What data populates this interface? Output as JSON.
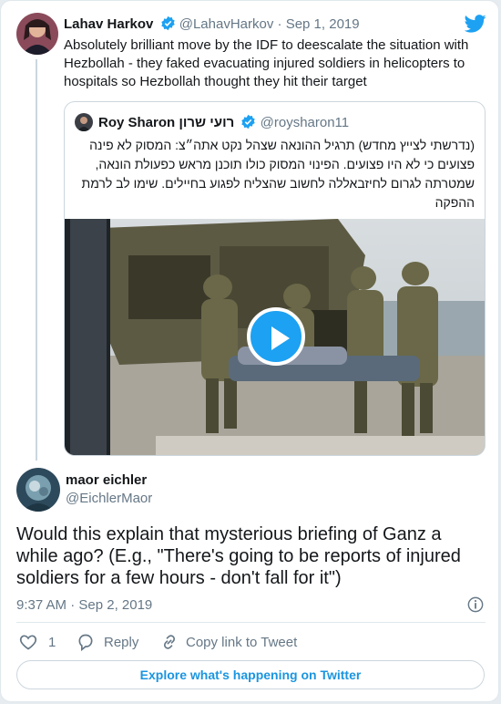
{
  "tweet1": {
    "name": "Lahav Harkov",
    "handle": "@LahavHarkov",
    "sep": "·",
    "date": "Sep 1, 2019",
    "text": "Absolutely brilliant move by the IDF to deescalate the situation with Hezbollah - they faked evacuating injured soldiers in helicopters to hospitals so Hezbollah thought they hit their target"
  },
  "quote": {
    "name": "Roy Sharon רועי שרון",
    "handle": "@roysharon11",
    "text": "(נדרשתי לצייץ מחדש) תרגיל ההונאה שצהל נקט אתה״צ: המסוק לא פינה פצועים כי לא היו פצועים. הפינוי המסוק כולו תוכנן מראש כפעולת הונאה, שמטרתה לגרום לחיזבאללה לחשוב שהצליח לפגוע בחיילים. שימו לב לרמת ההפקה"
  },
  "tweet2": {
    "name": "maor eichler",
    "handle": "@EichlerMaor",
    "text": "Would this explain that mysterious briefing of Ganz a while ago? (E.g., \"There's going to be reports of injured soldiers for a few hours - don't fall for it\")",
    "timestamp": "9:37 AM · Sep 2, 2019"
  },
  "actions": {
    "like_count": "1",
    "reply_label": "Reply",
    "copy_label": "Copy link to Tweet"
  },
  "footer": {
    "explore_label": "Explore what's happening on Twitter"
  },
  "colors": {
    "brand": "#1da1f2",
    "link": "#1b95e0",
    "muted": "#657786",
    "border": "#ccd6dd"
  },
  "icons": [
    "twitter-bird-icon",
    "verified-icon",
    "play-icon",
    "info-icon",
    "heart-icon",
    "reply-icon",
    "link-icon"
  ]
}
